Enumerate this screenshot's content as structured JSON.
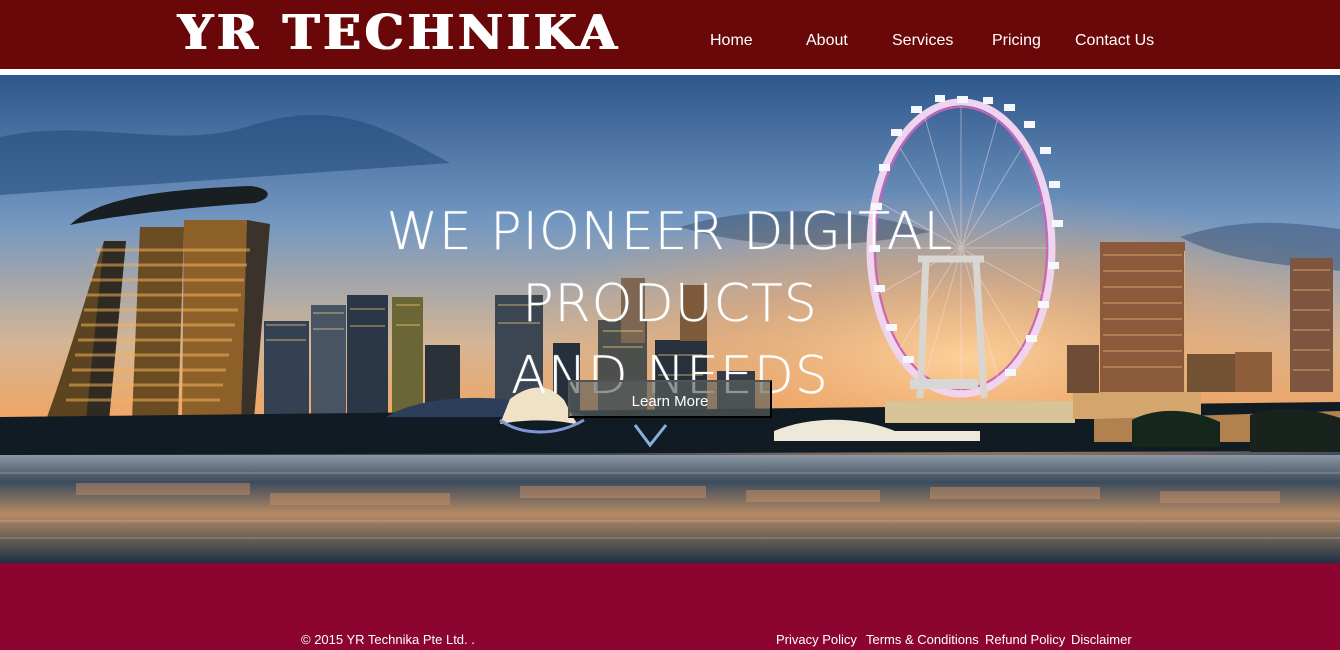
{
  "brand": {
    "name": "YR TECHNIKA"
  },
  "nav": {
    "items": [
      {
        "label": "Home"
      },
      {
        "label": "About"
      },
      {
        "label": "Services"
      },
      {
        "label": "Pricing"
      },
      {
        "label": "Contact Us"
      }
    ]
  },
  "hero": {
    "headline_line1": "WE PIONEER DIGITAL PRODUCTS",
    "headline_line2": "AND NEEDS",
    "button_label": "Learn More"
  },
  "footer": {
    "copyright": "© 2015 YR Technika Pte Ltd. .",
    "links": [
      {
        "label": "Privacy Policy"
      },
      {
        "label": "Terms & Conditions"
      },
      {
        "label": "Refund Policy"
      },
      {
        "label": "Disclaimer"
      }
    ]
  },
  "colors": {
    "header": "#6a0708",
    "footer": "#8c0530",
    "text": "#ffffff"
  },
  "icons": {
    "hero_image": "singapore-skyline-at-dusk"
  }
}
